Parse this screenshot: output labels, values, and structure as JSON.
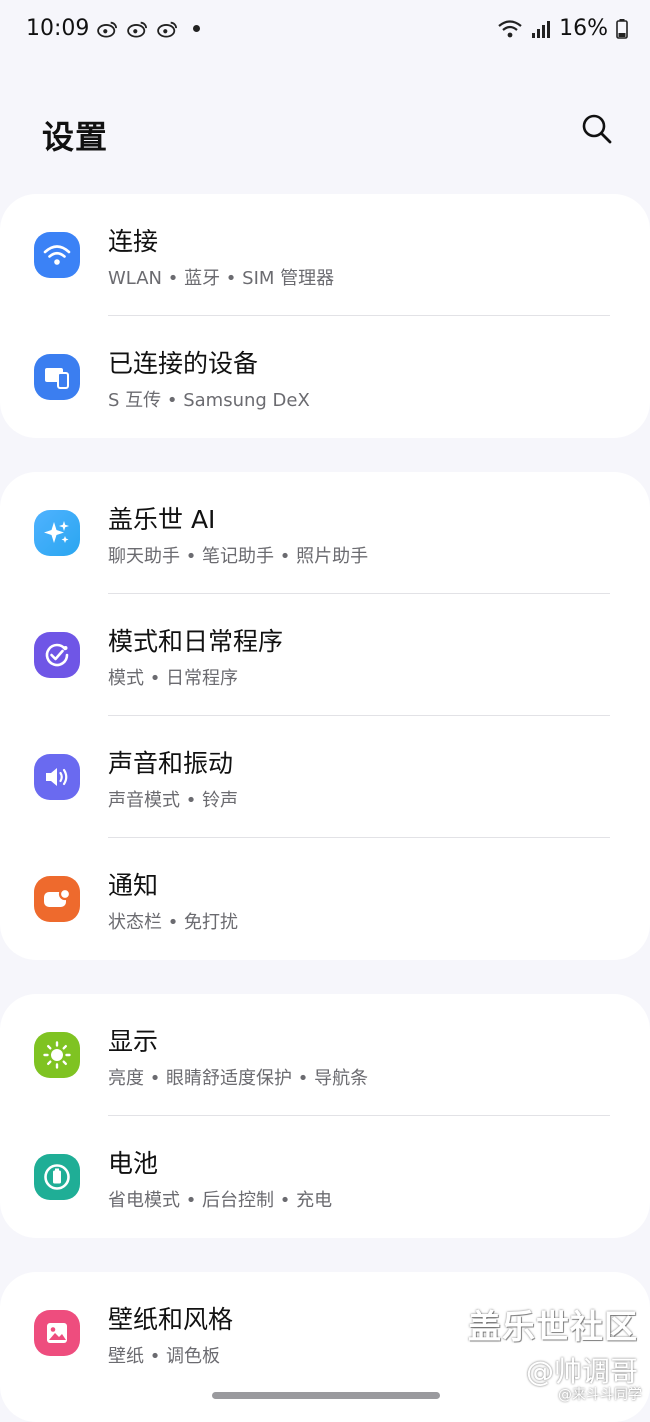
{
  "status_bar": {
    "time": "10:09",
    "battery": "16%",
    "icons": [
      "weibo-icon",
      "weibo-icon",
      "weibo-icon",
      "notification-dot-icon",
      "wifi-icon",
      "signal-icon",
      "battery-icon"
    ]
  },
  "header": {
    "title": "设置",
    "search_icon": "search-icon"
  },
  "groups": [
    {
      "items": [
        {
          "title": "连接",
          "subtitle": "WLAN • 蓝牙 • SIM 管理器",
          "icon": "wifi-icon",
          "color": "#3b82f6"
        },
        {
          "title": "已连接的设备",
          "subtitle": "S 互传 • Samsung DeX",
          "icon": "devices-icon",
          "color": "#3b7ef0"
        }
      ]
    },
    {
      "items": [
        {
          "title": "盖乐世 AI",
          "subtitle": "聊天助手 • 笔记助手 • 照片助手",
          "icon": "sparkle-icon",
          "color": "#2aa6f0"
        },
        {
          "title": "模式和日常程序",
          "subtitle": "模式 • 日常程序",
          "icon": "routine-icon",
          "color": "#6f56e6"
        },
        {
          "title": "声音和振动",
          "subtitle": "声音模式 • 铃声",
          "icon": "volume-icon",
          "color": "#6a6af0"
        },
        {
          "title": "通知",
          "subtitle": "状态栏 • 免打扰",
          "icon": "notification-icon",
          "color": "#ee6a2d"
        }
      ]
    },
    {
      "items": [
        {
          "title": "显示",
          "subtitle": "亮度 • 眼睛舒适度保护 • 导航条",
          "icon": "sun-icon",
          "color": "#7fc322"
        },
        {
          "title": "电池",
          "subtitle": "省电模式 • 后台控制 • 充电",
          "icon": "battery-care-icon",
          "color": "#1fae96"
        }
      ]
    },
    {
      "items": [
        {
          "title": "壁纸和风格",
          "subtitle": "壁纸 • 调色板",
          "icon": "wallpaper-icon",
          "color": "#ee4d7e"
        }
      ]
    }
  ],
  "watermark": {
    "line1": "盖乐世社区",
    "line2": "@帅调哥",
    "line3": "@来斗斗同学"
  }
}
